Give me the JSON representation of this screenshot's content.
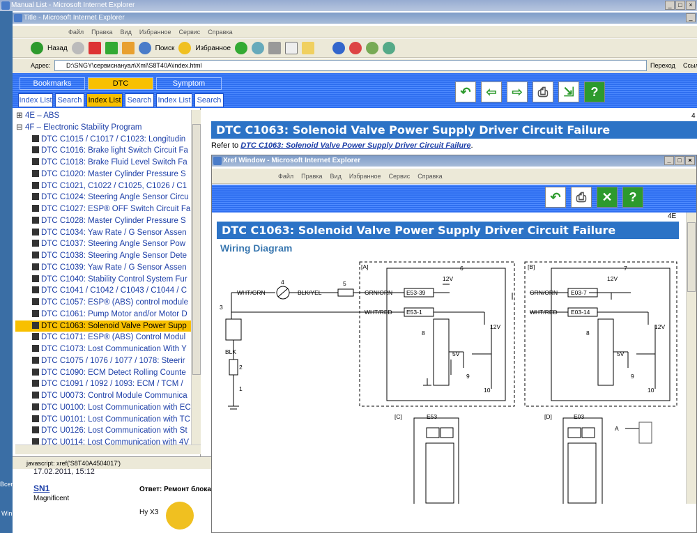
{
  "outer": {
    "title": "Manual List - Microsoft Internet Explorer"
  },
  "main_window": {
    "title": "Title - Microsoft Internet Explorer",
    "menu": [
      "Файл",
      "Правка",
      "Вид",
      "Избранное",
      "Сервис",
      "Справка"
    ],
    "toolbar": {
      "back": "Назад",
      "search": "Поиск",
      "favorites": "Избранное"
    },
    "address_label": "Адрес:",
    "address": "D:\\SNGY\\сервиснануал\\Xml\\S8T40A\\index.html",
    "go": "Переход",
    "links": "Ссыл"
  },
  "nav": {
    "tabs": [
      "Bookmarks",
      "DTC",
      "Symptom"
    ],
    "buttons": [
      "Index List",
      "Search",
      "Index List",
      "Search",
      "Index List",
      "Search"
    ]
  },
  "tree": {
    "groups": [
      "4E – ABS",
      "4F – Electronic Stability Program"
    ],
    "items": [
      "DTC C1015 / C1017 / C1023: Longitudin",
      "DTC C1016: Brake light Switch Circuit Fa",
      "DTC C1018: Brake Fluid Level Switch Fa",
      "DTC C1020: Master Cylinder Pressure S",
      "DTC C1021, C1022 / C1025, C1026 / C1",
      "DTC C1024: Steering Angle Sensor Circu",
      "DTC C1027: ESP® OFF Switch Circuit Fa",
      "DTC C1028: Master Cylinder Pressure S",
      "DTC C1034: Yaw Rate / G Sensor Assen",
      "DTC C1037: Steering Angle Sensor Pow",
      "DTC C1038: Steering Angle Sensor Dete",
      "DTC C1039: Yaw Rate / G Sensor Assen",
      "DTC C1040: Stability Control System Fur",
      "DTC C1041 / C1042 / C1043 / C1044 / C",
      "DTC C1057: ESP® (ABS) control module",
      "DTC C1061: Pump Motor and/or Motor D",
      "DTC C1063: Solenoid Valve Power Supp",
      "DTC C1071: ESP® (ABS) Control Modul",
      "DTC C1073: Lost Communication With Y",
      "DTC C1075 / 1076 / 1077 / 1078: Steerir",
      "DTC C1090: ECM Detect Rolling Counte",
      "DTC C1091 / 1092 / 1093: ECM / TCM /",
      "DTC U0073: Control Module Communica",
      "DTC U0100: Lost Communication with EC",
      "DTC U0101: Lost Communication with TC",
      "DTC U0126: Lost Communication with St",
      "DTC U0114: Lost Communication with 4V"
    ],
    "selected_index": 16
  },
  "status": "javascript: xref('S8T40A4504017')",
  "content": {
    "page_num": "4",
    "heading": "DTC C1063: Solenoid Valve Power Supply Driver Circuit Failure",
    "refer_prefix": "Refer to ",
    "refer_link": "DTC C1063: Solenoid Valve Power Supply Driver Circuit Failure",
    "refer_suffix": "."
  },
  "xref": {
    "title": "Xref Window - Microsoft Internet Explorer",
    "menu": [
      "Файл",
      "Правка",
      "Вид",
      "Избранное",
      "Сервис",
      "Справка"
    ],
    "page_num": "4E",
    "heading": "DTC C1063: Solenoid Valve Power Supply Driver Circuit Failure",
    "subheading": "Wiring Diagram"
  },
  "diagram": {
    "A": "[A]",
    "B": "[B]",
    "C": "[C]",
    "D": "[D]",
    "E53": "E53",
    "E03": "E03",
    "wht_grn": "WHT/GRN",
    "blk_yel": "BLK/YEL",
    "grn_orn": "GRN/ORN",
    "wht_red": "WHT/RED",
    "blk": "BLK",
    "e53_39": "E53-39",
    "e53_1": "E53-1",
    "e03_7": "E03-7",
    "e03_14": "E03-14",
    "v12": "12V",
    "v5": "5V",
    "n1": "1",
    "n2": "2",
    "n3": "3",
    "n4": "4",
    "n5": "5",
    "n6": "6",
    "n7": "7",
    "n8": "8",
    "n9": "9",
    "n10": "10",
    "a_label": "A"
  },
  "forum": {
    "date": "17.02.2011, 15:12",
    "user": "SN1",
    "rank": "Magnificent",
    "reply": "Ответ: Ремонт блока",
    "text": "Ну ХЗ"
  },
  "desktop": {
    "left1": "Всег",
    "left2": "Win"
  }
}
